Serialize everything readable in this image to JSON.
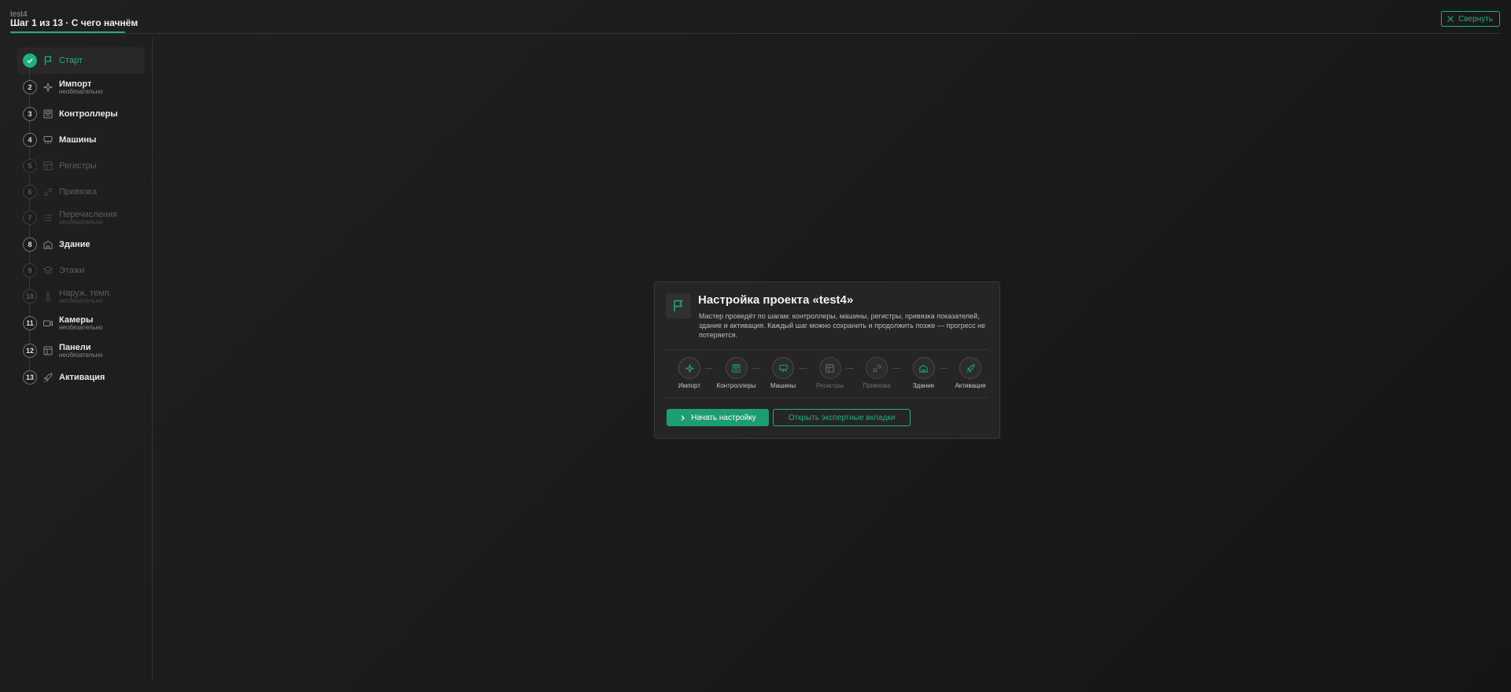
{
  "header": {
    "project_name": "test4",
    "step_title": "Шаг 1 из 13 · С чего начнём",
    "collapse_label": "Свернуть"
  },
  "sidebar": {
    "steps": [
      {
        "num": "",
        "label": "Старт",
        "sub": "",
        "icon": "flag-icon",
        "state": "active"
      },
      {
        "num": "2",
        "label": "Импорт",
        "sub": "необязательно",
        "icon": "sparkle-icon",
        "state": "enabled"
      },
      {
        "num": "3",
        "label": "Контроллеры",
        "sub": "",
        "icon": "controller-icon",
        "state": "enabled"
      },
      {
        "num": "4",
        "label": "Машины",
        "sub": "",
        "icon": "machine-icon",
        "state": "enabled"
      },
      {
        "num": "5",
        "label": "Регистры",
        "sub": "",
        "icon": "table-icon",
        "state": "disabled"
      },
      {
        "num": "6",
        "label": "Привязка",
        "sub": "",
        "icon": "link-icon",
        "state": "disabled"
      },
      {
        "num": "7",
        "label": "Перечисления",
        "sub": "необязательно",
        "icon": "list-icon",
        "state": "disabled"
      },
      {
        "num": "8",
        "label": "Здание",
        "sub": "",
        "icon": "building-icon",
        "state": "enabled"
      },
      {
        "num": "9",
        "label": "Этажи",
        "sub": "",
        "icon": "layers-icon",
        "state": "disabled"
      },
      {
        "num": "10",
        "label": "Наруж. темп.",
        "sub": "необязательно",
        "icon": "thermometer-icon",
        "state": "disabled"
      },
      {
        "num": "11",
        "label": "Камеры",
        "sub": "необязательно",
        "icon": "camera-icon",
        "state": "enabled"
      },
      {
        "num": "12",
        "label": "Панели",
        "sub": "необязательно",
        "icon": "panel-icon",
        "state": "enabled"
      },
      {
        "num": "13",
        "label": "Активация",
        "sub": "",
        "icon": "rocket-icon",
        "state": "enabled"
      }
    ]
  },
  "card": {
    "icon": "flag-icon",
    "title": "Настройка проекта «test4»",
    "description": "Мастер проведёт по шагам: контроллеры, машины, регистры, привязка показателей, здание и активация. Каждый шаг можно сохранить и продолжить позже — прогресс не потеряется.",
    "flow": [
      {
        "label": "Импорт",
        "icon": "sparkle-icon",
        "state": "enabled"
      },
      {
        "label": "Контроллеры",
        "icon": "controller-icon",
        "state": "enabled"
      },
      {
        "label": "Машины",
        "icon": "machine-icon",
        "state": "enabled"
      },
      {
        "label": "Регистры",
        "icon": "table-icon",
        "state": "disabled"
      },
      {
        "label": "Привязка",
        "icon": "link-icon",
        "state": "disabled"
      },
      {
        "label": "Здание",
        "icon": "building-icon",
        "state": "enabled"
      },
      {
        "label": "Активация",
        "icon": "rocket-icon",
        "state": "enabled"
      }
    ],
    "primary_button": "Начать настройку",
    "secondary_button": "Открыть экспертные вкладки"
  },
  "colors": {
    "accent": "#1fb07e",
    "background": "#1c1c1c",
    "card": "#252525"
  }
}
